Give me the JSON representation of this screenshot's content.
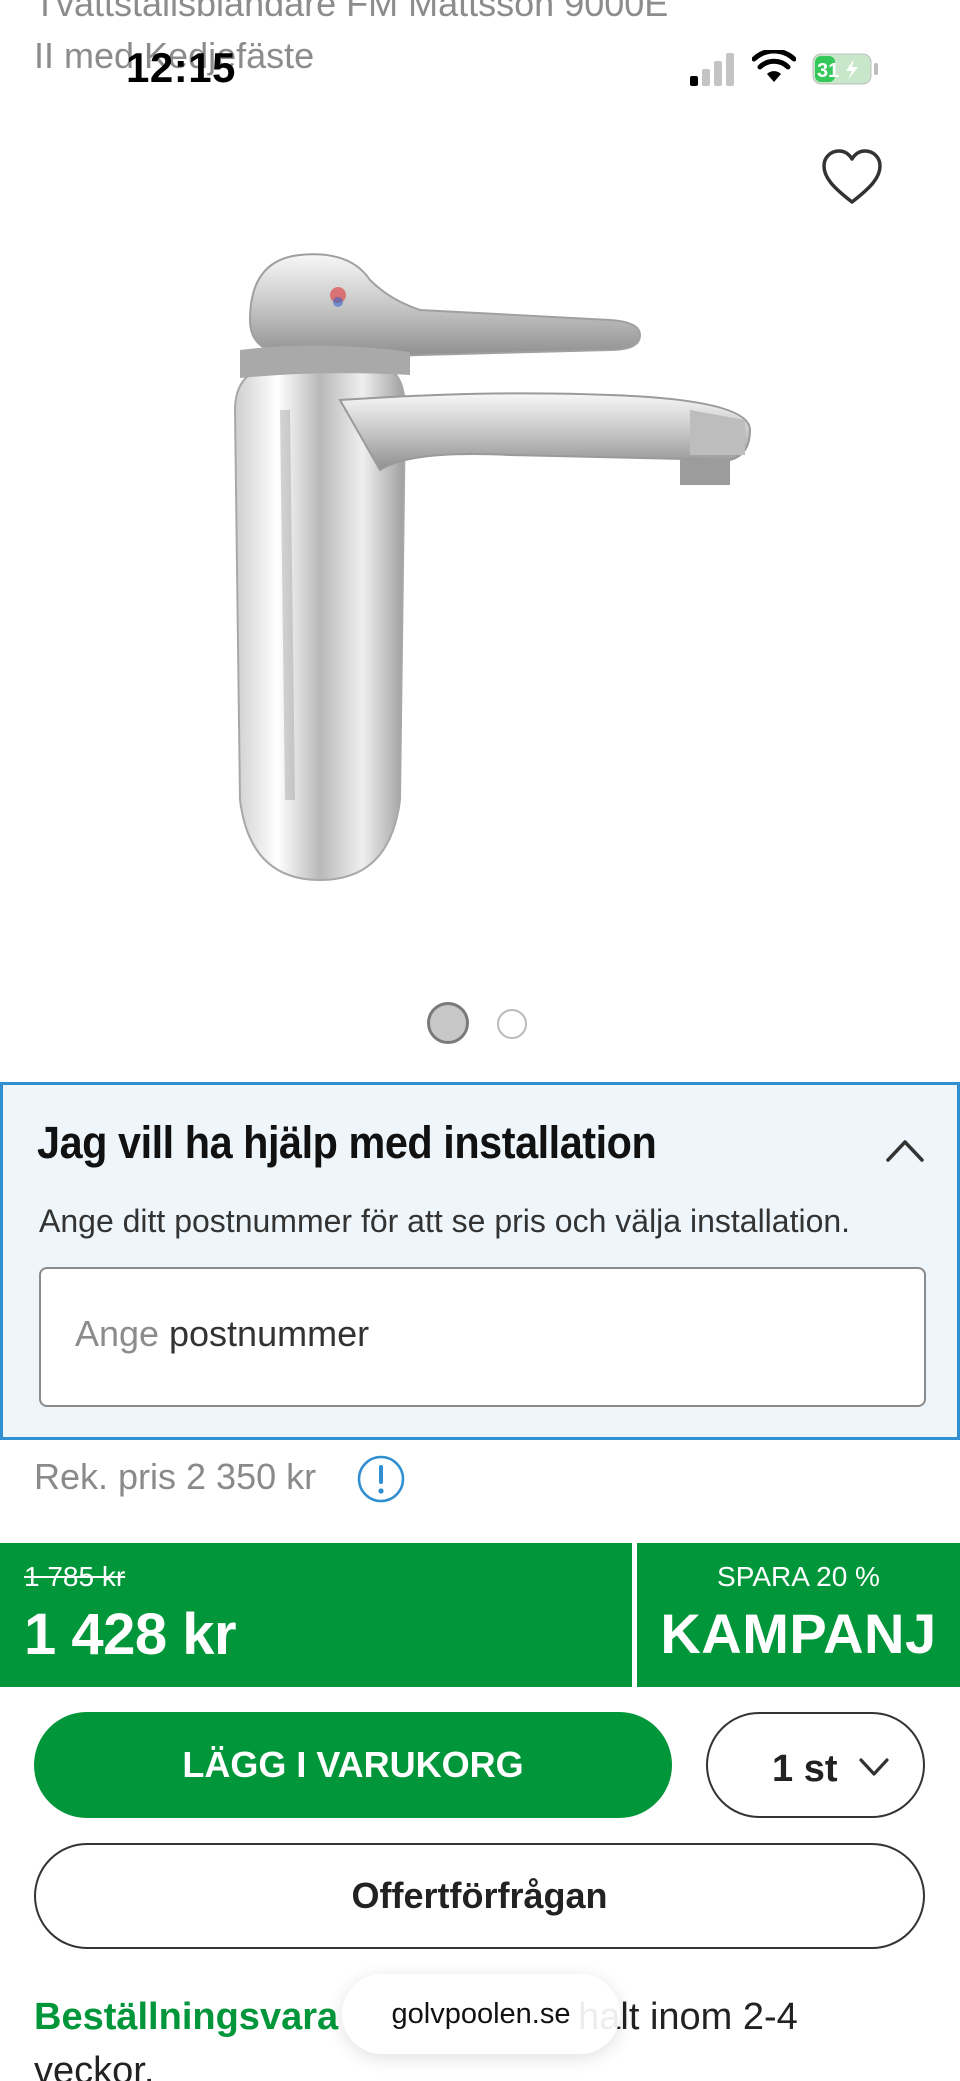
{
  "page": {
    "background_title": "Tvättställsblandare FM Mattsson 9000E II med Kedjefäste"
  },
  "status_bar": {
    "time": "12:15",
    "battery": "31"
  },
  "gallery": {
    "image_alt": "Tvättställsblandare FM Mattsson 9000E II",
    "dot_count": 2,
    "active_index": 0
  },
  "installation": {
    "title": "Jag vill ha hjälp med installation",
    "description": "Ange ditt postnummer för att se pris och välja installation.",
    "zip_placeholder": "Ange",
    "zip_value": "postnummer"
  },
  "pricing": {
    "recommended": "Rek. pris 2 350 kr",
    "old_price": "1 785 kr",
    "new_price": "1 428 kr",
    "savings": "SPARA 20 %",
    "campaign": "KAMPANJ"
  },
  "actions": {
    "add_to_cart": "LÄGG I VARUKORG",
    "quantity": "1 st",
    "offer_request": "Offertförfrågan"
  },
  "availability": {
    "status": "Beställningsvara",
    "text_part1": "halt inom 2-4",
    "text_part2": "veckor."
  },
  "browser": {
    "url": "golvpoolen.se"
  },
  "colors": {
    "brand_green": "#009639",
    "info_blue": "#2f8fd0",
    "panel_bg": "#eef6fb"
  }
}
